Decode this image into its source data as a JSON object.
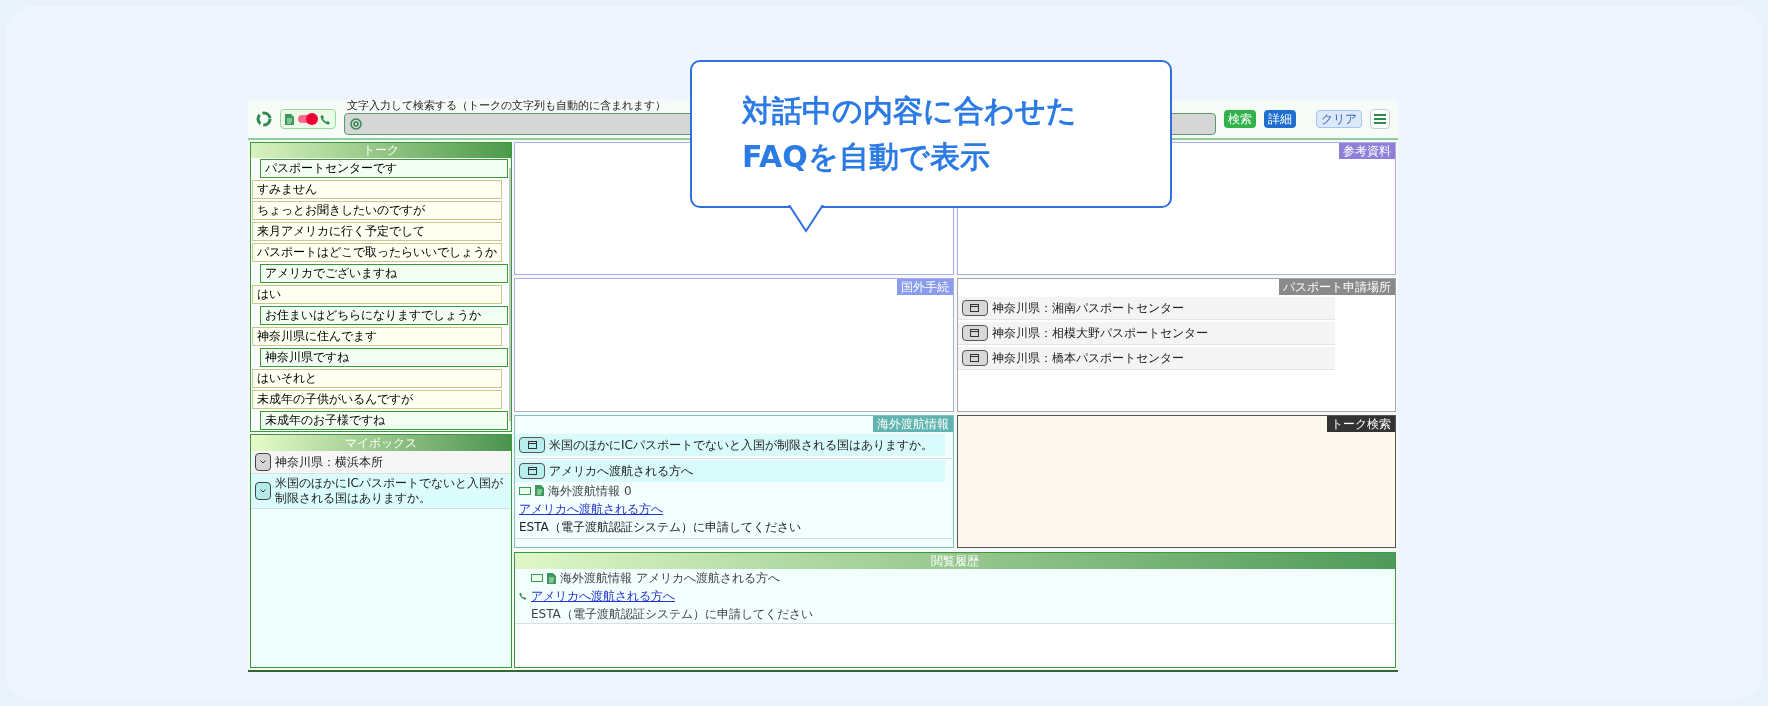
{
  "header": {
    "toggle": {
      "on": true
    },
    "search": {
      "legend": "文字入力して検索する（トークの文字列も自動的に含まれます）"
    },
    "buttons": [
      {
        "label": "検索",
        "kind": "search"
      },
      {
        "label": "詳細",
        "kind": "detail"
      },
      {
        "label": "クリア",
        "kind": "clear"
      }
    ]
  },
  "callout": {
    "lines": [
      "対話中の内容に合わせた",
      "FAQを自動で表示"
    ]
  },
  "talk": {
    "title": "トーク",
    "messages": [
      {
        "kind": "operator",
        "text": "パスポートセンターです"
      },
      {
        "kind": "customer",
        "text": "すみません"
      },
      {
        "kind": "customer",
        "text": "ちょっとお聞きしたいのですが"
      },
      {
        "kind": "customer",
        "text": "来月アメリカに行く予定でして"
      },
      {
        "kind": "customer",
        "text": "パスポートはどこで取ったらいいでしょうか"
      },
      {
        "kind": "operator",
        "text": "アメリカでございますね"
      },
      {
        "kind": "customer",
        "text": "はい"
      },
      {
        "kind": "operator",
        "text": "お住まいはどちらになりますでしょうか"
      },
      {
        "kind": "customer",
        "text": "神奈川県に住んでます"
      },
      {
        "kind": "operator",
        "text": "神奈川県ですね"
      },
      {
        "kind": "customer",
        "text": "はいそれと"
      },
      {
        "kind": "customer",
        "text": "未成年の子供がいるんですが"
      },
      {
        "kind": "operator",
        "text": "未成年のお子様ですね"
      }
    ]
  },
  "mybox": {
    "title": "マイボックス",
    "items": [
      {
        "kind": "place",
        "text": "神奈川県：横浜本所"
      },
      {
        "kind": "faq",
        "text": "米国のほかにICパスポートでないと入国が制限される国はありますか。"
      }
    ]
  },
  "panels": [
    {
      "kind": "empty"
    },
    {
      "kind": "empty",
      "title": "参考資料",
      "color": "#8f7fd8"
    },
    {
      "kind": "empty",
      "title": "国外手続",
      "color": "#8b9cec"
    },
    {
      "kind": "list",
      "title": "パスポート申請場所",
      "color": "#8a8a8a",
      "items": [
        {
          "text": "神奈川県：湘南パスポートセンター"
        },
        {
          "text": "神奈川県：相模大野パスポートセンター"
        },
        {
          "text": "神奈川県：橋本パスポートセンター"
        }
      ]
    },
    {
      "kind": "faq",
      "title": "海外渡航情報",
      "color": "#5fb4b0",
      "items": [
        {
          "text": "米国のほかにICパスポートでないと入国が制限される国はありますか。"
        },
        {
          "text": "アメリカへ渡航される方へ",
          "category": "海外渡航情報",
          "count": "0",
          "link": "アメリカへ渡航される方へ",
          "answer": "ESTA（電子渡航認証システム）に申請してください"
        }
      ]
    },
    {
      "kind": "talk_results",
      "title": "トーク検索",
      "color": "#333333"
    }
  ],
  "history": {
    "title": "閲覧履歴",
    "entries": [
      {
        "category": "海外渡航情報",
        "subject": "アメリカへ渡航される方へ",
        "link": "アメリカへ渡航される方へ",
        "answer": "ESTA（電子渡航認証システム）に申請してください"
      }
    ]
  }
}
